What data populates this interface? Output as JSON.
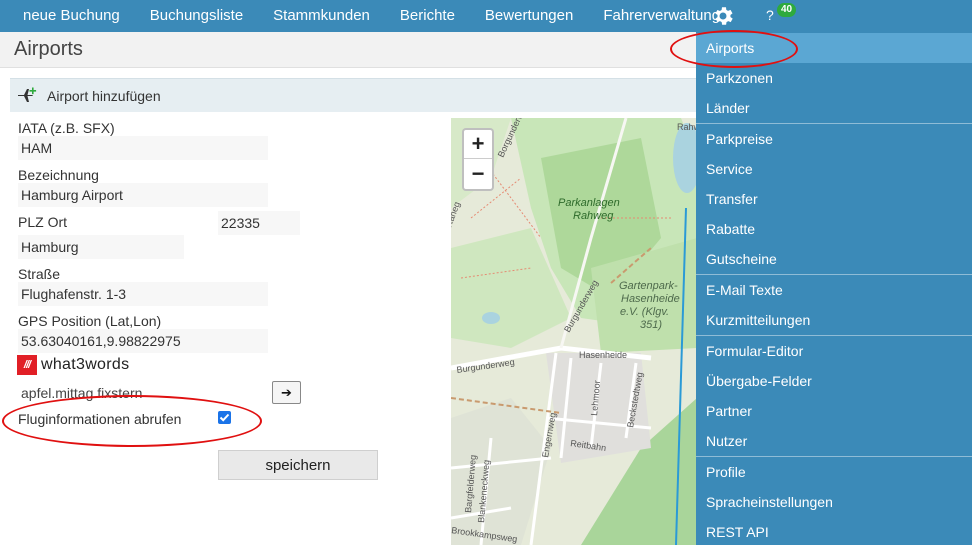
{
  "nav": {
    "items": [
      "neue Buchung",
      "Buchungsliste",
      "Stammkunden",
      "Berichte",
      "Bewertungen",
      "Fahrerverwaltung"
    ],
    "gear_icon": "gear-icon",
    "help": "?",
    "badge": "40"
  },
  "page": {
    "title": "Airports"
  },
  "section": {
    "title": "Airport hinzufügen",
    "icon": "plane-plus-icon"
  },
  "form": {
    "iata_label": "IATA (z.B. SFX)",
    "iata_value": "HAM",
    "name_label": "Bezeichnung",
    "name_value": "Hamburg Airport",
    "plz_label": "PLZ Ort",
    "plz_value": "22335",
    "city_value": "Hamburg",
    "street_label": "Straße",
    "street_value": "Flughafenstr. 1-3",
    "gps_label": "GPS Position (Lat,Lon)",
    "gps_value": "53.63040161,9.98822975",
    "w3w_brand": "what3words",
    "w3w_slashes": "///",
    "w3w_value": "apfel.mittag.fixstern",
    "arrow": "➔",
    "flight_label": "Fluginformationen abrufen",
    "flight_checked": true,
    "save_label": "speichern"
  },
  "map": {
    "zoom_in": "+",
    "zoom_out": "−",
    "labels": {
      "park1a": "Parkanlagen",
      "park1b": "Rahweg",
      "park2a": "Gartenpark-",
      "park2b": "Hasenheide",
      "park2c": "e.V. (Klgv.",
      "park2d": "351)",
      "street1": "Burgunderweg",
      "street2": "Burgunderweg",
      "street3": "Hasenheide",
      "street4": "Lehmoor",
      "street5": "Beckstedtweg",
      "street6": "Reitbahn",
      "street7": "Engernweg",
      "street8": "Bargfelderweg",
      "street9": "Blankeneckweg",
      "street10": "Brookkampsweg",
      "street11": "Borgunderweg",
      "street12": "Raheg",
      "street13": "Rahweg"
    }
  },
  "menu": {
    "items": [
      "Airports",
      "Parkzonen",
      "Länder",
      "Parkpreise",
      "Service",
      "Transfer",
      "Rabatte",
      "Gutscheine",
      "E-Mail Texte",
      "Kurzmitteilungen",
      "Formular-Editor",
      "Übergabe-Felder",
      "Partner",
      "Nutzer",
      "Profile",
      "Spracheinstellungen",
      "REST API"
    ],
    "active_index": 0
  },
  "colors": {
    "nav_bg": "#3b8ab8",
    "menu_active": "#5ba7d3",
    "annotation": "#e01010",
    "w3w_red": "#e11f26"
  }
}
